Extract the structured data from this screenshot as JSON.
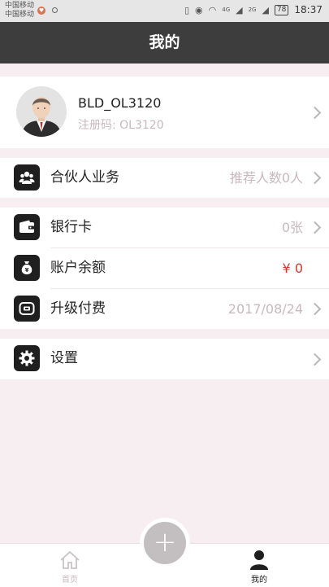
{
  "status_bar": {
    "carrier_1": "中国移动",
    "carrier_2": "中国移动",
    "network_1": "4G",
    "network_2": "2G",
    "battery": "78",
    "time": "18:37"
  },
  "title": "我的",
  "profile": {
    "username": "BLD_OL3120",
    "reg_code": "注册码: OL3120"
  },
  "menu": {
    "partner": {
      "label": "合伙人业务",
      "value": "推荐人数0人",
      "icon": "partner-icon"
    },
    "bank_card": {
      "label": "银行卡",
      "value": "0张",
      "icon": "wallet-icon"
    },
    "balance": {
      "label": "账户余额",
      "value": "¥ 0",
      "icon": "money-bag-icon"
    },
    "upgrade": {
      "label": "升级付费",
      "value": "2017/08/24",
      "icon": "upgrade-icon"
    },
    "settings": {
      "label": "设置",
      "icon": "gear-icon"
    }
  },
  "tabs": {
    "home": "首页",
    "mine": "我的",
    "add": "+"
  },
  "colors": {
    "title_bar": "#3d3d3d",
    "background": "#f7eef1",
    "balance_red": "#d9362b",
    "muted_value": "#c9b8be"
  }
}
